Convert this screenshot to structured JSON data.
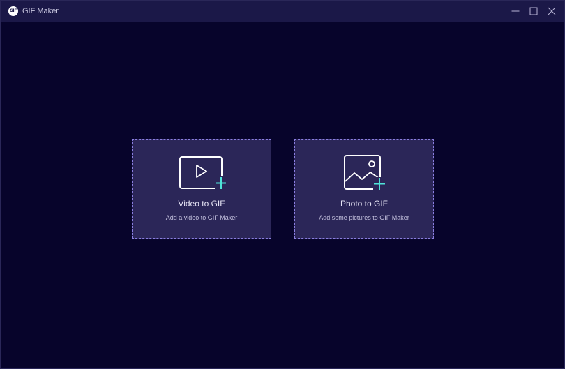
{
  "window": {
    "title": "GIF Maker",
    "logo_text": "GIF"
  },
  "options": [
    {
      "title": "Video to GIF",
      "subtitle": "Add a video to GIF Maker",
      "icon": "video-add-icon"
    },
    {
      "title": "Photo to GIF",
      "subtitle": "Add some pictures to GIF Maker",
      "icon": "photo-add-icon"
    }
  ],
  "colors": {
    "background": "#07042b",
    "titlebar": "#1b1848",
    "card_background": "#2b2658",
    "card_border": "#8a7ee0",
    "accent_plus": "#4fe3d8"
  }
}
